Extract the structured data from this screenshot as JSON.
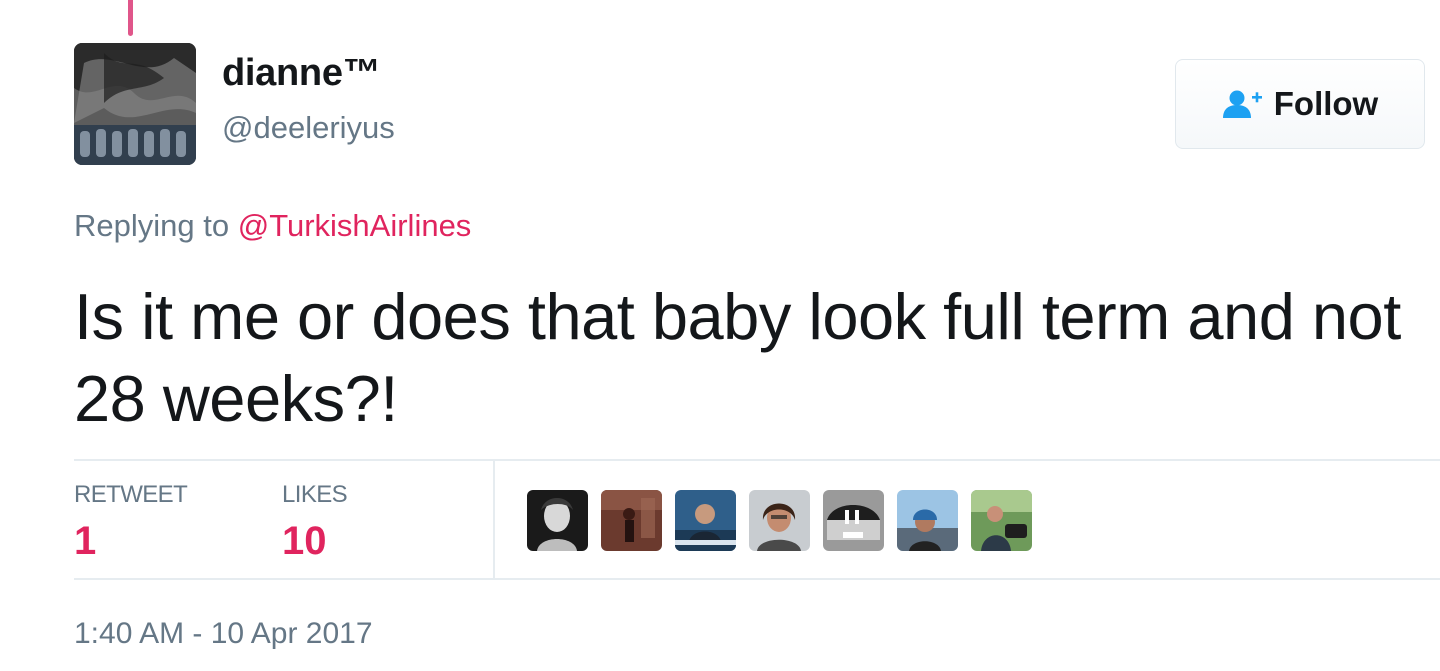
{
  "tweet": {
    "author": {
      "display_name": "dianne™",
      "screen_name": "@deeleriyus"
    },
    "follow_button": {
      "label": "Follow",
      "icon": "follow-person-plus-icon"
    },
    "reply_context": {
      "prefix": "Replying to",
      "mention": "@TurkishAirlines"
    },
    "text": "Is it me or does that baby look full term and not 28 weeks?!",
    "stats": {
      "retweets": {
        "label": "RETWEET",
        "count": "1"
      },
      "likes": {
        "label": "LIKES",
        "count": "10"
      }
    },
    "liker_avatar_count": 7,
    "timestamp": "1:40 AM - 10 Apr 2017"
  },
  "colors": {
    "accent": "#e0245e",
    "thread_line": "#e0568a",
    "secondary_text": "#657786",
    "primary_text": "#14171a",
    "follow_icon": "#1da1f2",
    "divider": "#e6ecf0"
  }
}
